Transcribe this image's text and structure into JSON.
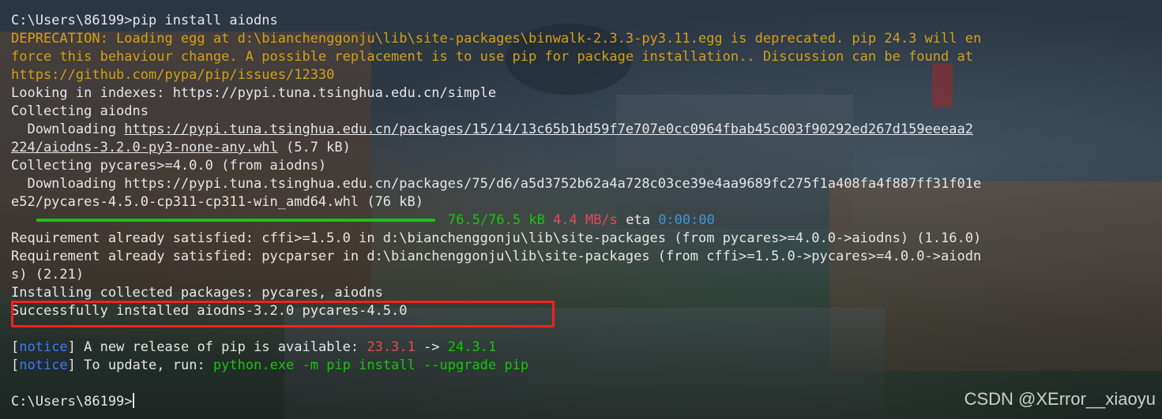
{
  "terminal": {
    "prompt1": "C:\\Users\\86199>pip install aiodns",
    "deprecation_1": "DEPRECATION: Loading egg at d:\\bianchenggonju\\lib\\site-packages\\binwalk-2.3.3-py3.11.egg is deprecated. pip 24.3 will en",
    "deprecation_2": "force this behaviour change. A possible replacement is to use pip for package installation.. Discussion can be found at",
    "deprecation_3": "https://github.com/pypa/pip/issues/12330",
    "looking": "Looking in indexes: https://pypi.tuna.tsinghua.edu.cn/simple",
    "collecting_aiodns": "Collecting aiodns",
    "download1_prefix": "  Downloading ",
    "download1_url_1": "https://pypi.tuna.tsinghua.edu.cn/packages/15/14/13c65b1bd59f7e707e0cc0964fbab45c003f90292ed267d159eeeaa2",
    "download1_url_2": "224/aiodns-3.2.0-py3-none-any.whl",
    "download1_size": " (5.7 kB)",
    "collecting_pycares": "Collecting pycares>=4.0.0 (from aiodns)",
    "download2_1": "  Downloading https://pypi.tuna.tsinghua.edu.cn/packages/75/d6/a5d3752b62a4a728c03ce39e4aa9689fc275f1a408fa4f887ff31f01e",
    "download2_2": "e52/pycares-4.5.0-cp311-cp311-win_amd64.whl (76 kB)",
    "progress": {
      "fraction": 1.0,
      "size_text": "76.5/76.5 kB",
      "speed_text": "4.4 MB/s",
      "eta_label": "eta",
      "eta_value": "0:00:00"
    },
    "req_cffi": "Requirement already satisfied: cffi>=1.5.0 in d:\\bianchenggonju\\lib\\site-packages (from pycares>=4.0.0->aiodns) (1.16.0)",
    "req_pycparser_1": "Requirement already satisfied: pycparser in d:\\bianchenggonju\\lib\\site-packages (from cffi>=1.5.0->pycares>=4.0.0->aiodn",
    "req_pycparser_2": "s) (2.21)",
    "installing": "Installing collected packages: pycares, aiodns",
    "success": "Successfully installed aiodns-3.2.0 pycares-4.5.0",
    "notice1": {
      "open": "[",
      "tag": "notice",
      "close": "]",
      "text": " A new release of pip is available: ",
      "old_version": "23.3.1",
      "arrow": " -> ",
      "new_version": "24.3.1"
    },
    "notice2": {
      "open": "[",
      "tag": "notice",
      "close": "]",
      "text": " To update, run: ",
      "command": "python.exe -m pip install --upgrade pip"
    },
    "prompt2": "C:\\Users\\86199>"
  },
  "watermark": "CSDN @XError__xiaoyu",
  "colors": {
    "warning": "#d4a017",
    "success": "#16c60c",
    "old_version": "#e74856",
    "notice_tag": "#3b78ff",
    "eta": "#3a96dd",
    "highlight_box": "#ff1f1f"
  }
}
